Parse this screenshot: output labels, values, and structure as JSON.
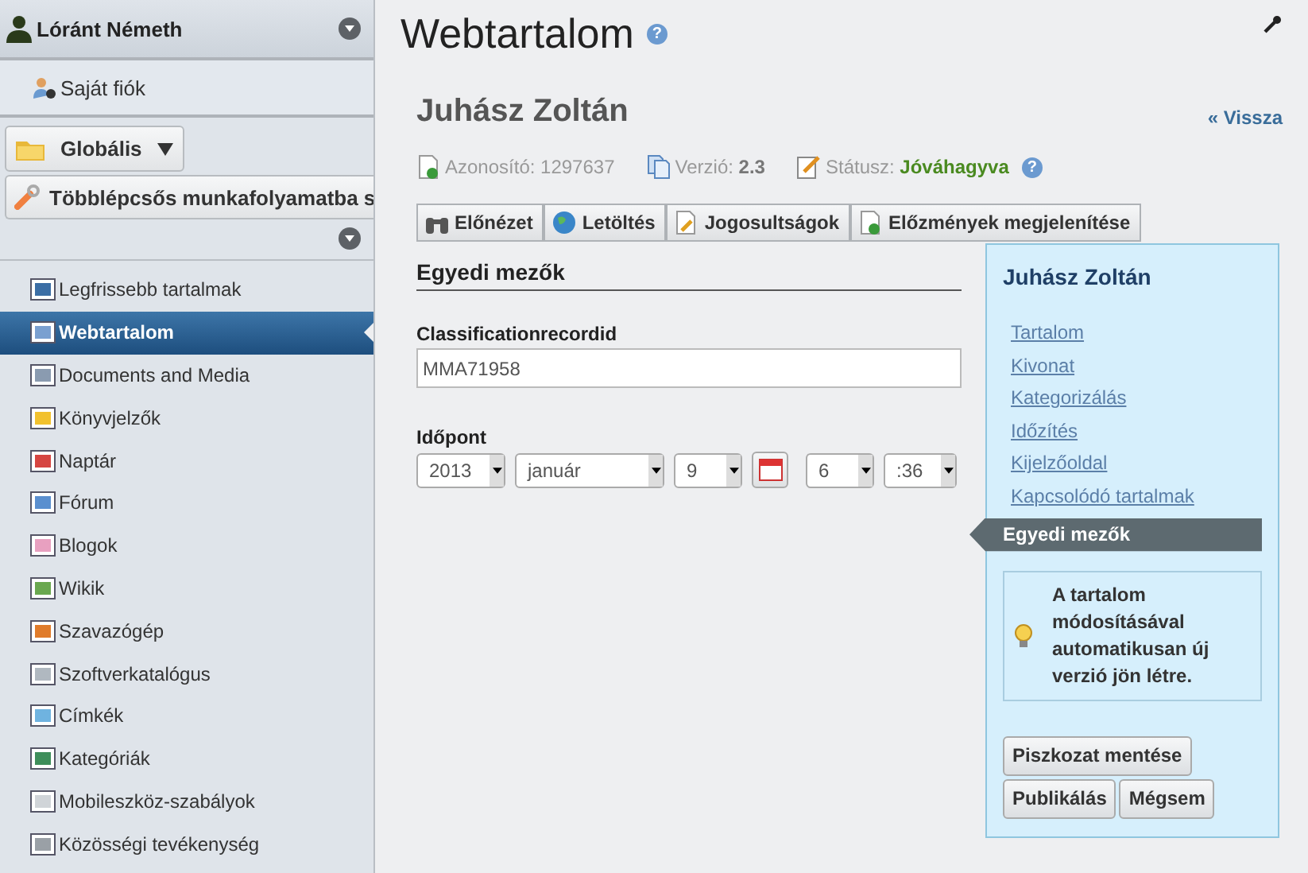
{
  "user": {
    "name": "Lóránt Németh",
    "account_link": "Saját fiók"
  },
  "scope": {
    "label": "Globális"
  },
  "workflow": {
    "label": "Többlépcsős munkafolyamatba s"
  },
  "nav_items": [
    {
      "label": "Legfrissebb tartalmak",
      "selected": false
    },
    {
      "label": "Webtartalom",
      "selected": true
    },
    {
      "label": "Documents and Media",
      "selected": false
    },
    {
      "label": "Könyvjelzők",
      "selected": false
    },
    {
      "label": "Naptár",
      "selected": false
    },
    {
      "label": "Fórum",
      "selected": false
    },
    {
      "label": "Blogok",
      "selected": false
    },
    {
      "label": "Wikik",
      "selected": false
    },
    {
      "label": "Szavazógép",
      "selected": false
    },
    {
      "label": "Szoftverkatalógus",
      "selected": false
    },
    {
      "label": "Címkék",
      "selected": false
    },
    {
      "label": "Kategóriák",
      "selected": false
    },
    {
      "label": "Mobileszköz-szabályok",
      "selected": false
    },
    {
      "label": "Közösségi tevékenység",
      "selected": false
    }
  ],
  "page_title": "Webtartalom",
  "title_help": "?",
  "article": {
    "title": "Juhász Zoltán",
    "back_link": "« Vissza"
  },
  "meta": {
    "id_label": "Azonosító:",
    "id_value": "1297637",
    "version_label": "Verzió:",
    "version_value": "2.3",
    "status_label": "Státusz:",
    "status_value": "Jóváhagyva",
    "help": "?"
  },
  "toolbar": [
    "Előnézet",
    "Letöltés",
    "Jogosultságok",
    "Előzmények megjelenítése"
  ],
  "section_title": "Egyedi mezők",
  "fields": {
    "classification_label": "Classificationrecordid",
    "classification_value": "MMA71958",
    "date_label": "Időpont",
    "year": "2013",
    "month": "január",
    "day": "9",
    "hour": "6",
    "minute": ":36"
  },
  "panel": {
    "title": "Juhász Zoltán",
    "links": [
      {
        "label": "Tartalom",
        "selected": false
      },
      {
        "label": "Kivonat",
        "selected": false
      },
      {
        "label": "Kategorizálás",
        "selected": false
      },
      {
        "label": "Időzítés",
        "selected": false
      },
      {
        "label": "Kijelzőoldal",
        "selected": false
      },
      {
        "label": "Kapcsolódó tartalmak",
        "selected": false
      },
      {
        "label": "Egyedi mezők",
        "selected": true
      }
    ],
    "tip": "A tartalom módosításával automatikusan új verzió jön létre.",
    "buttons": [
      "Piszkozat mentése",
      "Publikálás",
      "Mégsem"
    ]
  }
}
